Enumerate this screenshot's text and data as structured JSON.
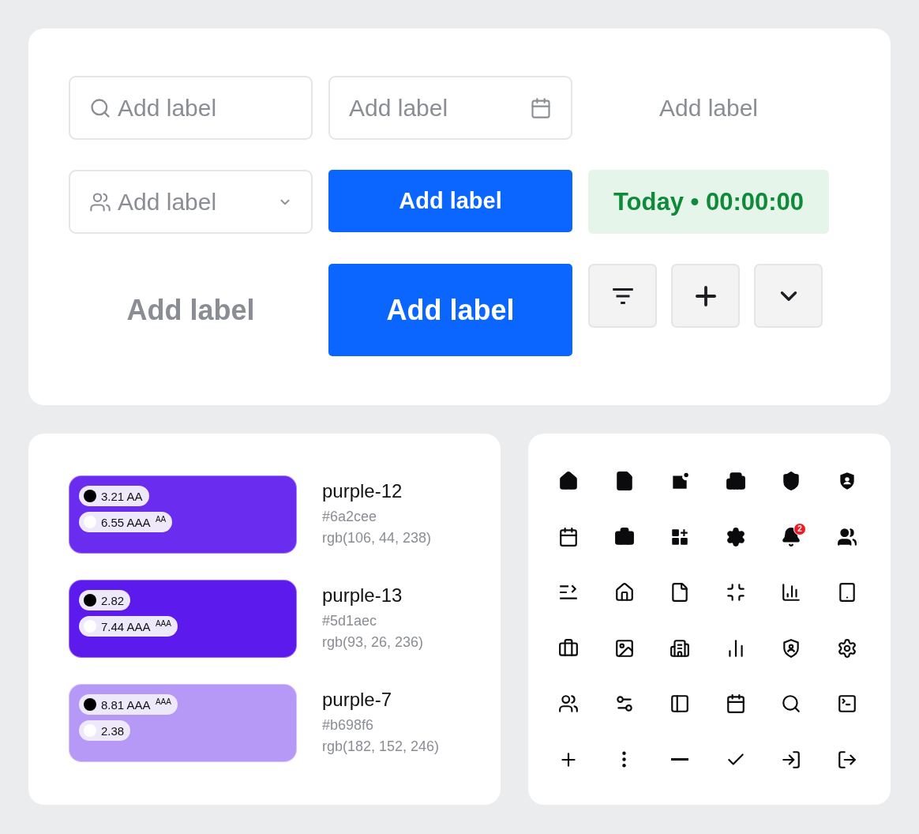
{
  "controls": [
    {
      "kind": "search",
      "placeholder": "Add label"
    },
    {
      "kind": "date",
      "placeholder": "Add label"
    },
    {
      "kind": "label",
      "text": "Add label"
    },
    {
      "kind": "select",
      "placeholder": "Add label"
    },
    {
      "kind": "button",
      "text": "Add label"
    },
    {
      "kind": "status",
      "text": "Today • 00:00:00"
    },
    {
      "kind": "label-large",
      "text": "Add label"
    },
    {
      "kind": "button-large",
      "text": "Add label"
    },
    {
      "kind": "icon-buttons",
      "buttons": [
        {
          "kind": "filter"
        },
        {
          "kind": "plus"
        },
        {
          "kind": "chevron"
        }
      ]
    }
  ],
  "swatches": [
    {
      "name": "purple-12",
      "hex": "#6a2cee",
      "rgb": "rgb(106, 44, 238)",
      "color": "#6a2cee",
      "chips": [
        {
          "color": "#000000",
          "text": "3.21 AA"
        },
        {
          "color": "#ffffff",
          "text": "6.55 AAA $^{AA}$"
        }
      ]
    },
    {
      "name": "purple-13",
      "hex": "#5d1aec",
      "rgb": "rgb(93, 26, 236)",
      "color": "#5d1aec",
      "chips": [
        {
          "color": "#000000",
          "text": "2.82"
        },
        {
          "color": "#ffffff",
          "text": "7.44 AAA $^{AAA}$"
        }
      ]
    },
    {
      "name": "purple-7",
      "hex": "#b698f6",
      "rgb": "rgb(182, 152, 246)",
      "color": "#b698f6",
      "chips": [
        {
          "color": "#000000",
          "text": "8.81 AAA $^{AAA}$"
        },
        {
          "color": "#ffffff",
          "text": "2.38"
        }
      ]
    }
  ],
  "icon_grid": {
    "notification_count": "2"
  }
}
